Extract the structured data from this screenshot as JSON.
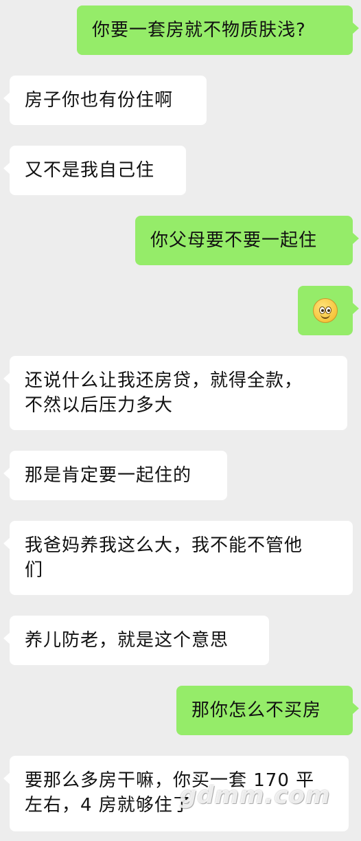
{
  "messages": [
    {
      "id": "m1",
      "side": "out",
      "text": "你要一套房就不物质肤浅?"
    },
    {
      "id": "m2",
      "side": "in",
      "text": "房子你也有份住啊"
    },
    {
      "id": "m3",
      "side": "in",
      "text": "又不是我自己住"
    },
    {
      "id": "m4",
      "side": "out",
      "text": "你父母要不要一起住"
    },
    {
      "id": "m5",
      "side": "out",
      "emoji": "smiling-face-emoji"
    },
    {
      "id": "m6",
      "side": "in",
      "text": "还说什么让我还房贷，就得全款，\n不然以后压力多大"
    },
    {
      "id": "m7",
      "side": "in",
      "text": "那是肯定要一起住的"
    },
    {
      "id": "m8",
      "side": "in",
      "text": "我爸妈养我这么大，我不能不管他\n们"
    },
    {
      "id": "m9",
      "side": "in",
      "text": "养儿防老，就是这个意思"
    },
    {
      "id": "m10",
      "side": "out",
      "text": "那你怎么不买房"
    },
    {
      "id": "m11",
      "side": "in",
      "text": "要那么多房干嘛，你买一套 170 平\n左右，4 房就够住了"
    }
  ],
  "watermark": "gdmm.com",
  "colors": {
    "background": "#ededed",
    "outgoing_bubble": "#95ec69",
    "incoming_bubble": "#ffffff",
    "text": "#111111"
  }
}
